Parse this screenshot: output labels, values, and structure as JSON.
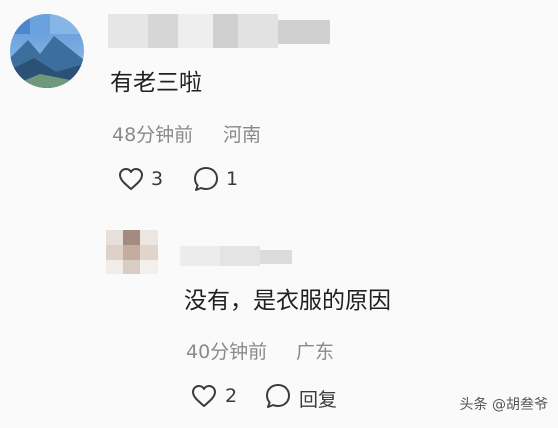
{
  "comments": [
    {
      "text": "有老三啦",
      "time": "48分钟前",
      "location": "河南",
      "likes": "3",
      "replies": "1"
    },
    {
      "text": "没有，是衣服的原因",
      "time": "40分钟前",
      "location": "广东",
      "likes": "2",
      "reply_label": "回复"
    }
  ],
  "watermark": "头条 @胡叁爷",
  "icons": {
    "like": "heart-outline-icon",
    "reply": "speech-bubble-icon"
  },
  "colors": {
    "meta": "#8a8a8a",
    "text": "#202020",
    "icon": "#3b3b3b"
  }
}
